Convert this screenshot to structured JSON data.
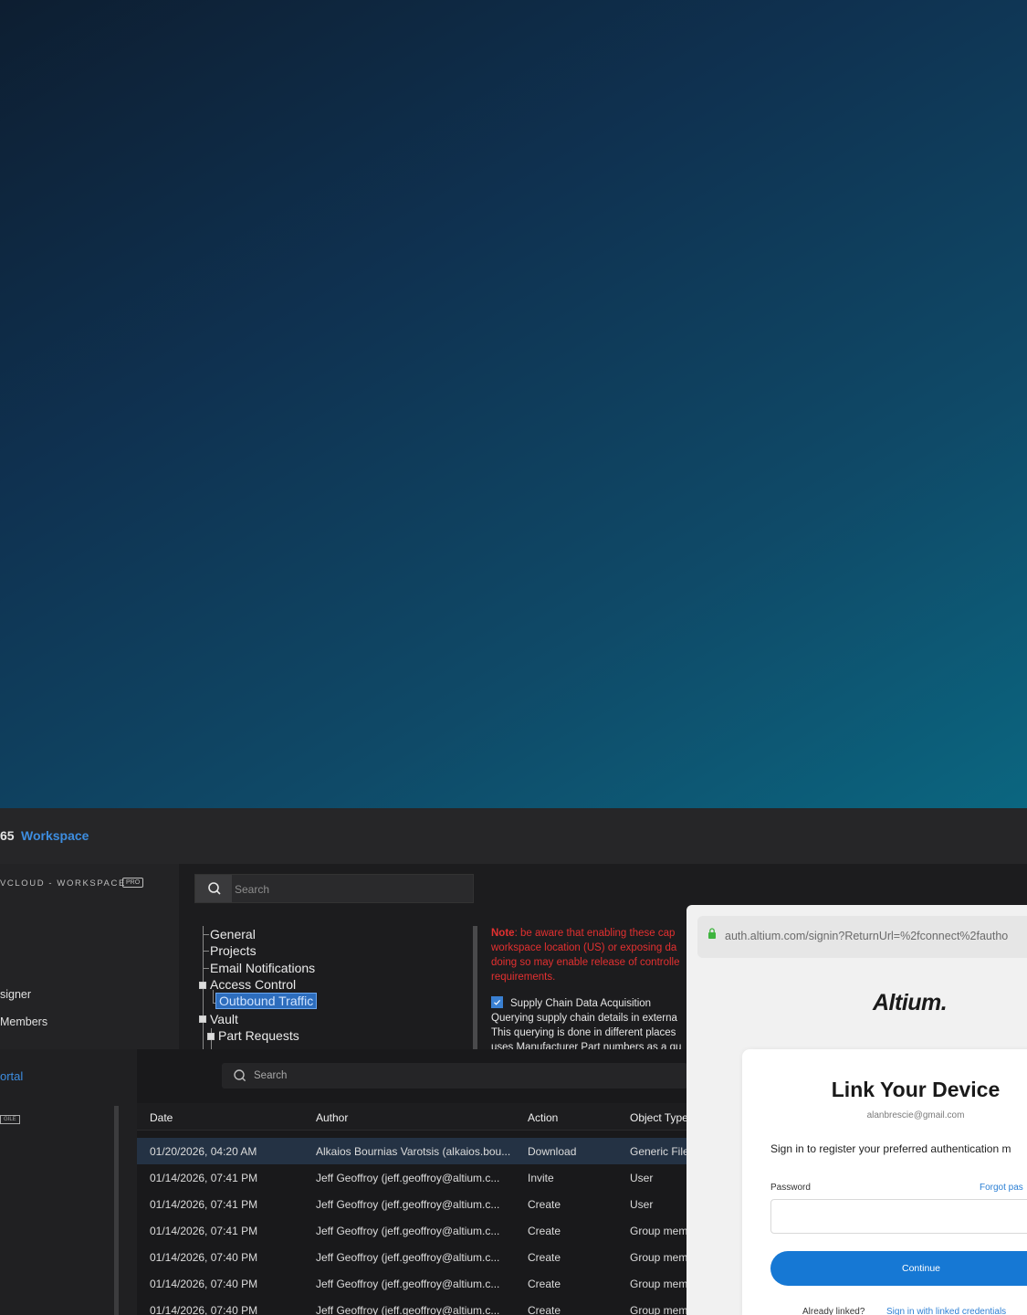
{
  "titlebar": {
    "prefix": "65",
    "workspace": "Workspace"
  },
  "left_pane": {
    "cloud_label": "VCLOUD - WORKSPACE",
    "pro_badge": "PRO",
    "items": [
      "signer",
      "Members"
    ]
  },
  "settings_search": {
    "placeholder": "Search"
  },
  "tree": {
    "items": [
      {
        "label": "General"
      },
      {
        "label": "Projects"
      },
      {
        "label": "Email Notifications"
      },
      {
        "label": "Access Control"
      },
      {
        "label": "Outbound Traffic",
        "selected": true
      },
      {
        "label": "Vault"
      },
      {
        "label": "Part Requests"
      }
    ]
  },
  "note": {
    "bold": "Note",
    "text": ": be aware that enabling these cap workspace location (US) or exposing da doing so may enable release of controlle requirements.",
    "checkbox_label": "Supply Chain Data Acquisition",
    "checked": true,
    "desc": "Querying supply chain details in externa This querying is done in different places uses Manufacturer Part numbers as a qu"
  },
  "portal": {
    "label": "ortal",
    "badge": "GILE"
  },
  "history_search": {
    "placeholder": "Search"
  },
  "table": {
    "headers": [
      "Date",
      "Author",
      "Action",
      "Object Type"
    ],
    "rows": [
      [
        "01/20/2026, 04:20 AM",
        "Alkaios Bournias Varotsis (alkaios.bou...",
        "Download",
        "Generic File"
      ],
      [
        "01/14/2026, 07:41 PM",
        "Jeff Geoffroy (jeff.geoffroy@altium.c...",
        "Invite",
        "User"
      ],
      [
        "01/14/2026, 07:41 PM",
        "Jeff Geoffroy (jeff.geoffroy@altium.c...",
        "Create",
        "User"
      ],
      [
        "01/14/2026, 07:41 PM",
        "Jeff Geoffroy (jeff.geoffroy@altium.c...",
        "Create",
        "Group memb"
      ],
      [
        "01/14/2026, 07:40 PM",
        "Jeff Geoffroy (jeff.geoffroy@altium.c...",
        "Create",
        "Group memb"
      ],
      [
        "01/14/2026, 07:40 PM",
        "Jeff Geoffroy (jeff.geoffroy@altium.c...",
        "Create",
        "Group memb"
      ],
      [
        "01/14/2026, 07:40 PM",
        "Jeff Geoffroy (jeff.geoffroy@altium.c...",
        "Create",
        "Group memb"
      ]
    ]
  },
  "browser": {
    "url": "auth.altium.com/signin?ReturnUrl=%2fconnect%2fautho",
    "logo": "Altium.",
    "title": "Link Your Device",
    "email": "alanbrescie@gmail.com",
    "message": "Sign in to register your preferred authentication m",
    "password_label": "Password",
    "forgot_link": "Forgot pas",
    "continue_label": "Continue",
    "already_linked": "Already linked?",
    "linked_link": "Sign in with linked credentials"
  },
  "colors": {
    "accent_blue": "#3d8de0",
    "note_red": "#e33030",
    "continue_blue": "#1678d4",
    "selected_tree_bg": "#2d6dbd"
  },
  "icons": [
    "search-icon",
    "lock-icon",
    "checkbox-checked-icon",
    "tree-expand-icon"
  ]
}
